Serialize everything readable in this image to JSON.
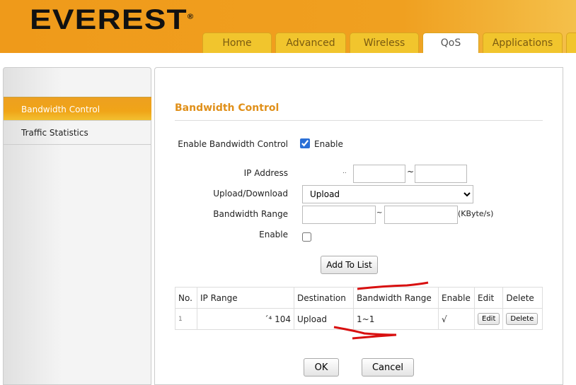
{
  "brand": "EVEREST",
  "tabs": [
    {
      "label": "Home"
    },
    {
      "label": "Advanced"
    },
    {
      "label": "Wireless"
    },
    {
      "label": "QoS"
    },
    {
      "label": "Applications"
    }
  ],
  "sidebar": {
    "items": [
      {
        "label": "Bandwidth Control"
      },
      {
        "label": "Traffic Statistics"
      }
    ]
  },
  "page": {
    "title": "Bandwidth Control"
  },
  "form": {
    "enable_bc_label": "Enable Bandwidth Control",
    "enable_text": "Enable",
    "ip_label": "IP Address",
    "ip_prefix": "..",
    "tilde": "~",
    "updown_label": "Upload/Download",
    "updown_value": "Upload",
    "bw_label": "Bandwidth Range",
    "bw_unit": "(KByte/s)",
    "enable_label": "Enable",
    "add_label": "Add To List"
  },
  "table": {
    "headers": [
      "No.",
      "IP Range",
      "Destination",
      "Bandwidth Range",
      "Enable",
      "Edit",
      "Delete"
    ],
    "rows": [
      {
        "no": "1",
        "ip": "´⁴ 104",
        "dest": "Upload",
        "range": "1~1",
        "enable": "√",
        "edit": "Edit",
        "delete": "Delete"
      }
    ]
  },
  "footer": {
    "ok": "OK",
    "cancel": "Cancel"
  }
}
